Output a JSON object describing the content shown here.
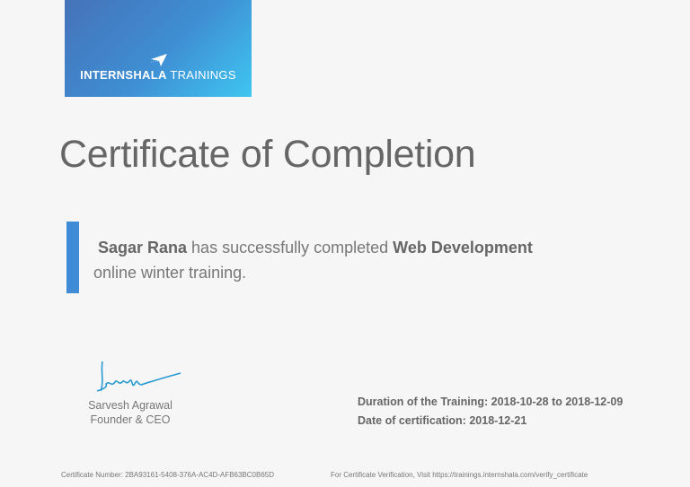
{
  "logo": {
    "brand": "INTERNSHALA",
    "product": "TRAININGS"
  },
  "title": "Certificate of Completion",
  "statement": {
    "name": "Sagar Rana",
    "text1": " has successfully completed ",
    "course": "Web Development",
    "text2": " online winter training."
  },
  "signer": {
    "signature": "Sarvesh",
    "name": "Sarvesh Agrawal",
    "role": "Founder & CEO"
  },
  "details": {
    "duration_label": "Duration of the Training:",
    "start": "2018-10-28",
    "to": "to",
    "end": "2018-12-09",
    "cert_label": "Date of certification:",
    "cert_date": "2018-12-21"
  },
  "footer": {
    "cert_number": "Certificate Number: 2BA93161-5408-376A-AC4D-AFB63BC0B65D",
    "verification": "For Certificate Verification, Visit https://trainings.internshala.com/verify_certificate"
  },
  "colors": {
    "accent": "#3f8bd6",
    "text": "#666666"
  }
}
